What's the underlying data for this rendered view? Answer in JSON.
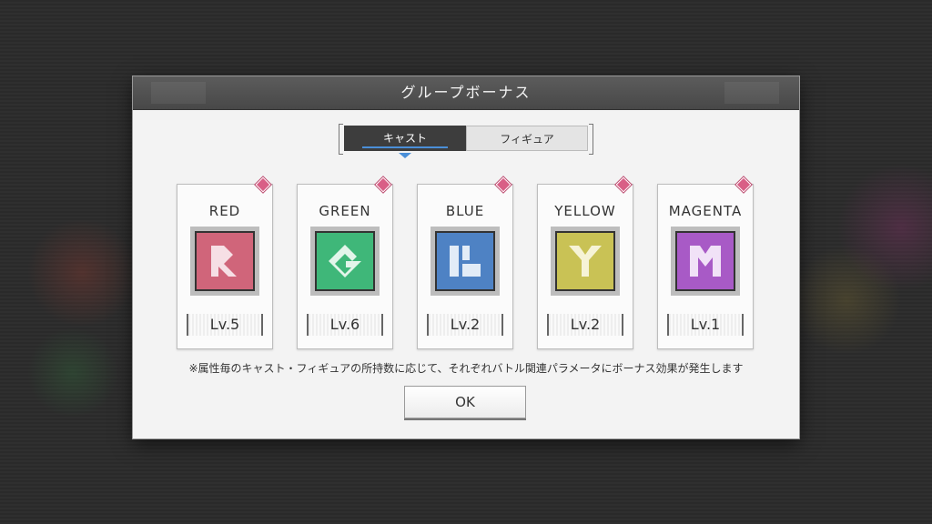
{
  "dialog": {
    "title": "グループボーナス",
    "tabs": [
      {
        "label": "キャスト",
        "active": true
      },
      {
        "label": "フィギュア",
        "active": false
      }
    ],
    "note": "※属性毎のキャスト・フィギュアの所持数に応じて、それぞれバトル関連パラメータにボーナス効果が発生します",
    "ok_label": "OK"
  },
  "groups": [
    {
      "name": "RED",
      "level": "Lv.5",
      "icon": "red-r-icon",
      "color": "#d0657a"
    },
    {
      "name": "GREEN",
      "level": "Lv.6",
      "icon": "green-g-icon",
      "color": "#3fb779"
    },
    {
      "name": "BLUE",
      "level": "Lv.2",
      "icon": "blue-b-icon",
      "color": "#4e82c4"
    },
    {
      "name": "YELLOW",
      "level": "Lv.2",
      "icon": "yellow-y-icon",
      "color": "#c9c255"
    },
    {
      "name": "MAGENTA",
      "level": "Lv.1",
      "icon": "magenta-m-icon",
      "color": "#a85ac6"
    }
  ]
}
